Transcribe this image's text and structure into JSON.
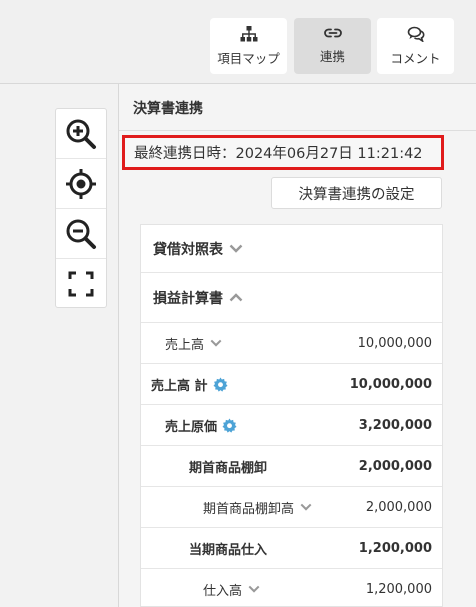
{
  "toolbar": {
    "items": [
      {
        "label": "項目マップ",
        "icon": "sitemap-icon",
        "active": false
      },
      {
        "label": "連携",
        "icon": "link-icon",
        "active": true
      },
      {
        "label": "コメント",
        "icon": "comment-icon",
        "active": false
      }
    ]
  },
  "zoom_controls": [
    "zoom-in-icon",
    "locate-icon",
    "zoom-out-icon",
    "fullscreen-icon"
  ],
  "panel": {
    "title": "決算書連携",
    "last_sync": "最終連携日時：2024年06月27日 11:21:42",
    "settings_button": "決算書連携の設定"
  },
  "statement": {
    "balance_sheet": "貸借対照表",
    "income_statement": "損益計算書",
    "rows": [
      {
        "name": "売上高",
        "value": "10,000,000",
        "expandable": true,
        "gear": false
      },
      {
        "name": "売上高 計",
        "value": "10,000,000",
        "expandable": false,
        "gear": true
      },
      {
        "name": "売上原価",
        "value": "3,200,000",
        "expandable": false,
        "gear": true
      },
      {
        "name": "期首商品棚卸",
        "value": "2,000,000",
        "expandable": false,
        "gear": false
      },
      {
        "name": "期首商品棚卸高",
        "value": "2,000,000",
        "expandable": true,
        "gear": false
      },
      {
        "name": "当期商品仕入",
        "value": "1,200,000",
        "expandable": false,
        "gear": false
      },
      {
        "name": "仕入高",
        "value": "1,200,000",
        "expandable": true,
        "gear": false
      }
    ]
  },
  "colors": {
    "highlight_border": "#e01b1b",
    "gear": "#4da3d6",
    "chevron": "#999999"
  }
}
